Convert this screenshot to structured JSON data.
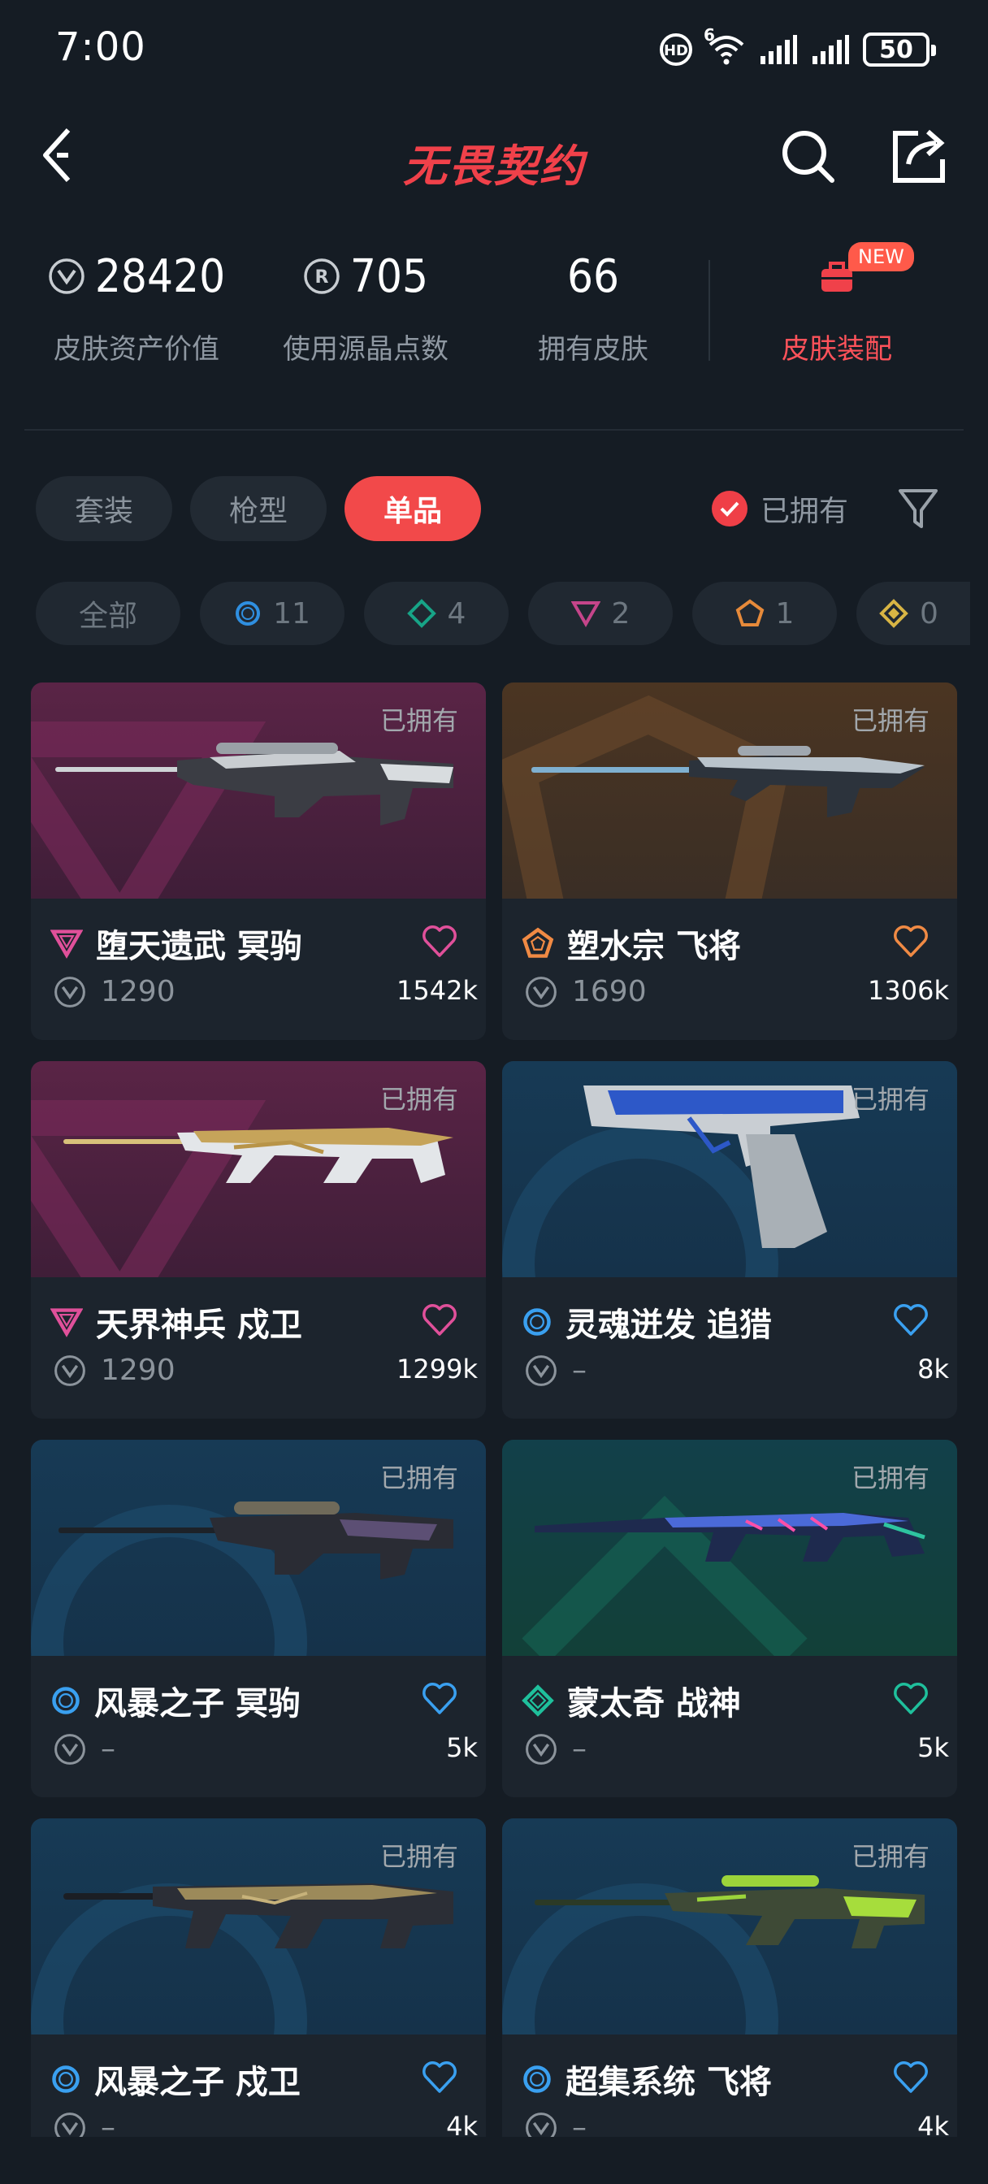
{
  "status_bar": {
    "time": "7:00",
    "network_badge": "6",
    "battery": "50"
  },
  "header": {
    "title": "无畏契约"
  },
  "stats": [
    {
      "value": "28420",
      "label": "皮肤资产价值",
      "icon": "vp-icon"
    },
    {
      "value": "705",
      "label": "使用源晶点数",
      "icon": "radianite-icon"
    },
    {
      "value": "66",
      "label": "拥有皮肤",
      "icon": ""
    }
  ],
  "loadout": {
    "label": "皮肤装配",
    "badge": "NEW"
  },
  "tabs": [
    {
      "label": "套装",
      "active": false
    },
    {
      "label": "枪型",
      "active": false
    },
    {
      "label": "单品",
      "active": true
    }
  ],
  "owned_filter": {
    "label": "已拥有",
    "checked": true
  },
  "rarity_chips": [
    {
      "label": "全部",
      "icon": ""
    },
    {
      "label": "11",
      "icon": "select-tier-icon",
      "color": "#2f8fe0"
    },
    {
      "label": "4",
      "icon": "deluxe-tier-icon",
      "color": "#17a487"
    },
    {
      "label": "2",
      "icon": "premium-tier-icon",
      "color": "#c5458a"
    },
    {
      "label": "1",
      "icon": "exclusive-tier-icon",
      "color": "#e68a3a"
    },
    {
      "label": "0",
      "icon": "ultra-tier-icon",
      "color": "#d8b544"
    }
  ],
  "skins": [
    {
      "name": "堕天遗武 冥驹",
      "price": "1290",
      "likes": "1542k",
      "owned": "已拥有",
      "tier": "premium",
      "tier_color": "#e0509a",
      "heart_color": "#e0509a"
    },
    {
      "name": "塑水宗 飞将",
      "price": "1690",
      "likes": "1306k",
      "owned": "已拥有",
      "tier": "exclusive",
      "tier_color": "#f08a44",
      "heart_color": "#f08a44"
    },
    {
      "name": "天界神兵 戍卫",
      "price": "1290",
      "likes": "1299k",
      "owned": "已拥有",
      "tier": "premium",
      "tier_color": "#e0509a",
      "heart_color": "#e0509a"
    },
    {
      "name": "灵魂迸发 追猎",
      "price": "–",
      "likes": "8k",
      "owned": "已拥有",
      "tier": "select",
      "tier_color": "#3aa0f0",
      "heart_color": "#3aa0f0"
    },
    {
      "name": "风暴之子 冥驹",
      "price": "–",
      "likes": "5k",
      "owned": "已拥有",
      "tier": "select",
      "tier_color": "#3aa0f0",
      "heart_color": "#3aa0f0"
    },
    {
      "name": "蒙太奇 战神",
      "price": "–",
      "likes": "5k",
      "owned": "已拥有",
      "tier": "deluxe",
      "tier_color": "#1fc09c",
      "heart_color": "#1fc09c"
    },
    {
      "name": "风暴之子 戍卫",
      "price": "–",
      "likes": "4k",
      "owned": "已拥有",
      "tier": "select",
      "tier_color": "#3aa0f0",
      "heart_color": "#3aa0f0"
    },
    {
      "name": "超集系统 飞将",
      "price": "–",
      "likes": "4k",
      "owned": "已拥有",
      "tier": "select",
      "tier_color": "#3aa0f0",
      "heart_color": "#3aa0f0"
    }
  ]
}
